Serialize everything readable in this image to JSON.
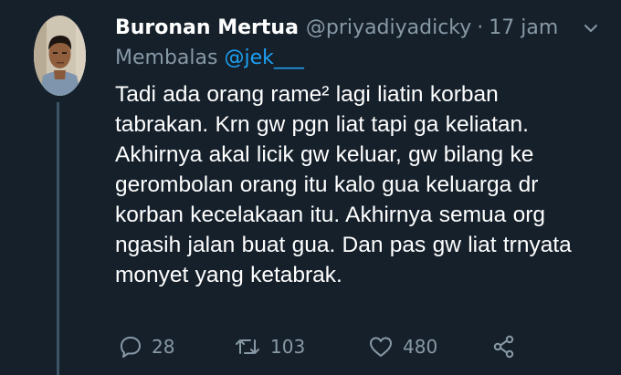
{
  "tweet": {
    "display_name": "Buronan Mertua",
    "handle": "@priyadiyadicky",
    "separator": "·",
    "time": "17 jam",
    "reply_prefix": "Membalas",
    "reply_to": "@jek___",
    "text": "Tadi ada orang rame² lagi liatin korban\ntabrakan. Krn gw pgn liat tapi ga keliatan.\nAkhirnya akal licik gw keluar, gw bilang ke\ngerombolan orang itu kalo gua keluarga dr\nkorban kecelakaan itu. Akhirnya semua org\nngasih jalan buat gua. Dan pas gw liat trnyata\nmonyet yang ketabrak."
  },
  "actions": {
    "reply_count": "28",
    "retweet_count": "103",
    "like_count": "480"
  },
  "icons": {
    "caret": "chevron-down-icon",
    "reply": "reply-icon",
    "retweet": "retweet-icon",
    "like": "heart-icon",
    "share": "share-icon"
  },
  "colors": {
    "background": "#15202b",
    "text_primary": "#ffffff",
    "text_secondary": "#8899a6",
    "mention": "#1da1f2",
    "thread_line": "#3d5466"
  }
}
